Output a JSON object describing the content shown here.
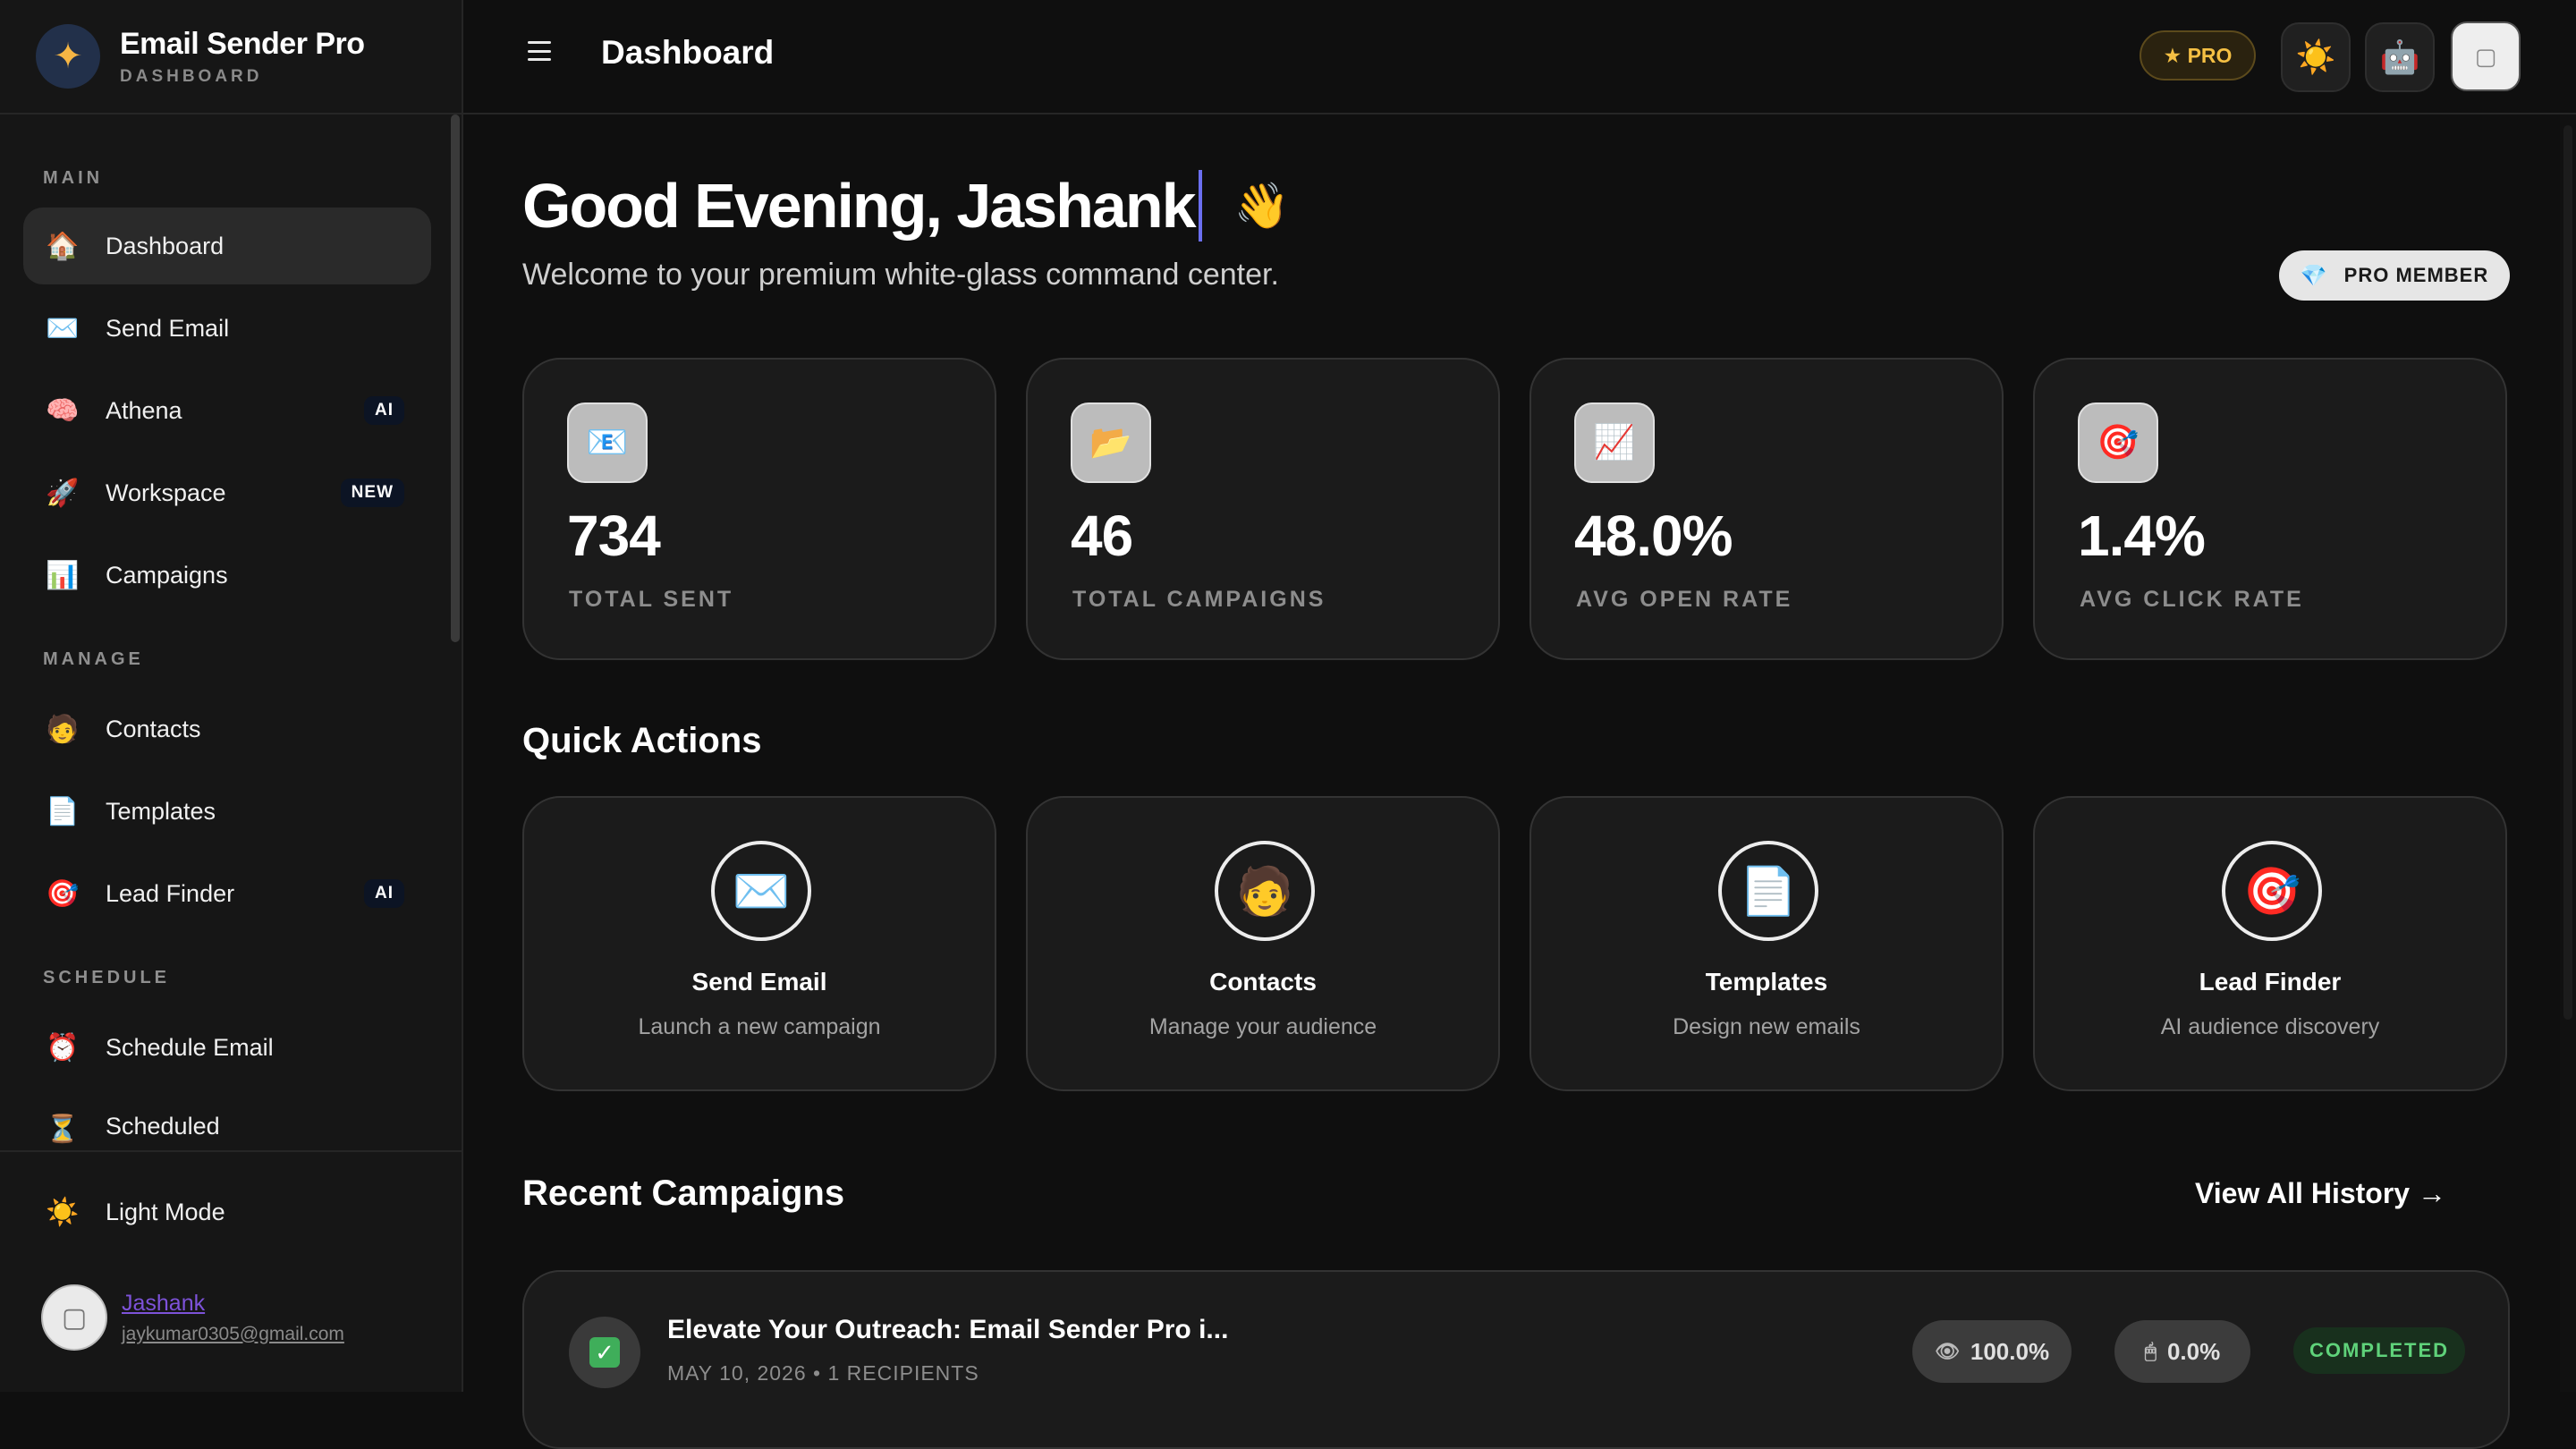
{
  "brand": {
    "title": "Email Sender Pro",
    "subtitle": "DASHBOARD"
  },
  "sidebar": {
    "sections": [
      {
        "label": "MAIN"
      },
      {
        "label": "MANAGE"
      },
      {
        "label": "SCHEDULE"
      }
    ],
    "items": [
      {
        "label": "Dashboard",
        "icon": "🏠",
        "badge": ""
      },
      {
        "label": "Send Email",
        "icon": "✉️",
        "badge": ""
      },
      {
        "label": "Athena",
        "icon": "🧠",
        "badge": "AI"
      },
      {
        "label": "Workspace",
        "icon": "🚀",
        "badge": "NEW"
      },
      {
        "label": "Campaigns",
        "icon": "📊",
        "badge": ""
      },
      {
        "label": "Contacts",
        "icon": "🧑",
        "badge": ""
      },
      {
        "label": "Templates",
        "icon": "📄",
        "badge": ""
      },
      {
        "label": "Lead Finder",
        "icon": "🎯",
        "badge": "AI"
      },
      {
        "label": "Schedule Email",
        "icon": "⏰",
        "badge": ""
      },
      {
        "label": "Scheduled",
        "icon": "⏳",
        "badge": ""
      }
    ],
    "light_mode": {
      "label": "Light Mode",
      "icon": "☀️"
    },
    "user": {
      "name": "Jashank",
      "email": "jaykumar0305@gmail.com"
    }
  },
  "topbar": {
    "title": "Dashboard",
    "pro_label": "★ PRO",
    "theme_icon": "☀️",
    "bot_icon": "🤖"
  },
  "main": {
    "greeting": "Good Evening, Jashank",
    "wave_icon": "👋",
    "welcome": "Welcome to your premium white-glass command center.",
    "pro_member": {
      "icon": "💎",
      "label": "PRO MEMBER"
    },
    "stats": [
      {
        "icon": "📧",
        "value": "734",
        "label": "TOTAL SENT"
      },
      {
        "icon": "📂",
        "value": "46",
        "label": "TOTAL CAMPAIGNS"
      },
      {
        "icon": "📈",
        "value": "48.0%",
        "label": "AVG OPEN RATE"
      },
      {
        "icon": "🎯",
        "value": "1.4%",
        "label": "AVG CLICK RATE"
      }
    ],
    "quick_actions_title": "Quick Actions",
    "quick_actions": [
      {
        "icon": "✉️",
        "name": "Send Email",
        "desc": "Launch a new campaign"
      },
      {
        "icon": "🧑",
        "name": "Contacts",
        "desc": "Manage your audience"
      },
      {
        "icon": "📄",
        "name": "Templates",
        "desc": "Design new emails"
      },
      {
        "icon": "🎯",
        "name": "Lead Finder",
        "desc": "AI audience discovery"
      }
    ],
    "recent_title": "Recent Campaigns",
    "view_all": "View All History →",
    "campaigns": [
      {
        "title": "Elevate Your Outreach: Email Sender Pro i...",
        "meta": "MAY 10, 2026 • 1 RECIPIENTS",
        "open_rate": "100.0%",
        "open_icon": "👁",
        "click_rate": "0.0%",
        "click_icon": "🖱",
        "status": "COMPLETED"
      }
    ]
  }
}
